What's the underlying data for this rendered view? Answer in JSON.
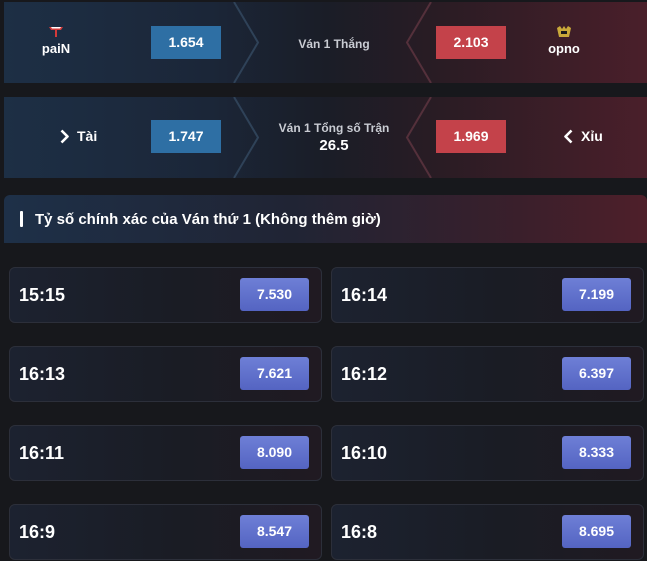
{
  "match_winner": {
    "home_team": "paiN",
    "home_odd": "1.654",
    "label": "Ván 1 Thắng",
    "away_odd": "2.103",
    "away_team": "opno"
  },
  "total": {
    "over_label": "Tài",
    "over_odd": "1.747",
    "label": "Ván 1 Tổng số Trận",
    "line": "26.5",
    "under_odd": "1.969",
    "under_label": "Xỉu"
  },
  "correct_score": {
    "title": "Tỷ số chính xác của Ván thứ 1 (Không thêm giờ)",
    "rows": [
      [
        {
          "score": "15:15",
          "odd": "7.530"
        },
        {
          "score": "16:14",
          "odd": "7.199"
        }
      ],
      [
        {
          "score": "16:13",
          "odd": "7.621"
        },
        {
          "score": "16:12",
          "odd": "6.397"
        }
      ],
      [
        {
          "score": "16:11",
          "odd": "8.090"
        },
        {
          "score": "16:10",
          "odd": "8.333"
        }
      ],
      [
        {
          "score": "16:9",
          "odd": "8.547"
        },
        {
          "score": "16:8",
          "odd": "8.695"
        }
      ]
    ]
  },
  "colors": {
    "home_odd_bg": "#2e6fa4",
    "away_odd_bg": "#c4424a",
    "score_odd_bg": "#5f6fcc"
  }
}
